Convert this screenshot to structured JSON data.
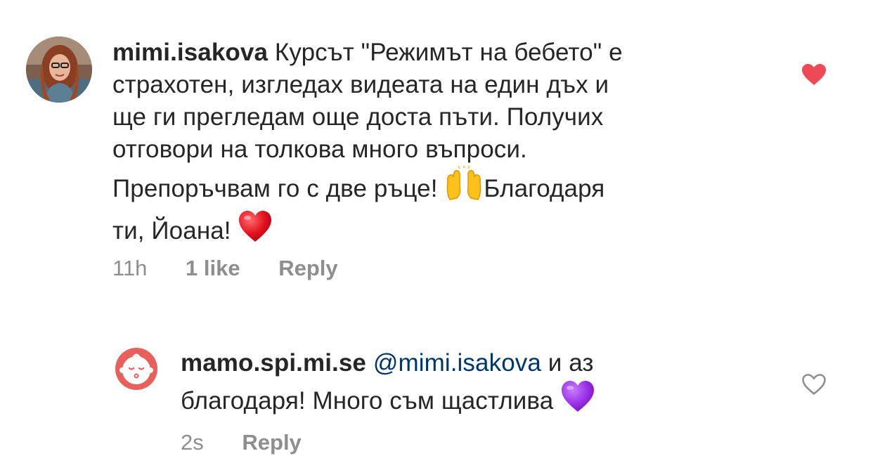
{
  "comments": [
    {
      "username": "mimi.isakova",
      "text_lines": [
        "Курсът \"Режимът на бебето\" е",
        "страхотен, изгледах видеата на един дъх и",
        "ще ги прегледам още доста пъти. Получих",
        "отговори на толкова много въпроси.",
        "Препоръчвам го с две ръце! ",
        "Благодаря",
        "ти, Йоана! "
      ],
      "time": "11h",
      "likes": "1 like",
      "reply_label": "Reply",
      "liked": true,
      "emojis": [
        "raising-hands",
        "red-heart"
      ]
    },
    {
      "username": "mamo.spi.mi.se",
      "mention": "@mimi.isakova",
      "text_after_mention": " и аз",
      "text_line2": "благодаря! Много съм щастлива ",
      "time": "2s",
      "reply_label": "Reply",
      "liked": false,
      "emojis": [
        "purple-heart"
      ]
    }
  ],
  "colors": {
    "text": "#262626",
    "meta": "#8e8e8e",
    "mention": "#00376b",
    "like_red": "#ed4956",
    "avatar_brand": "#e8605b"
  }
}
